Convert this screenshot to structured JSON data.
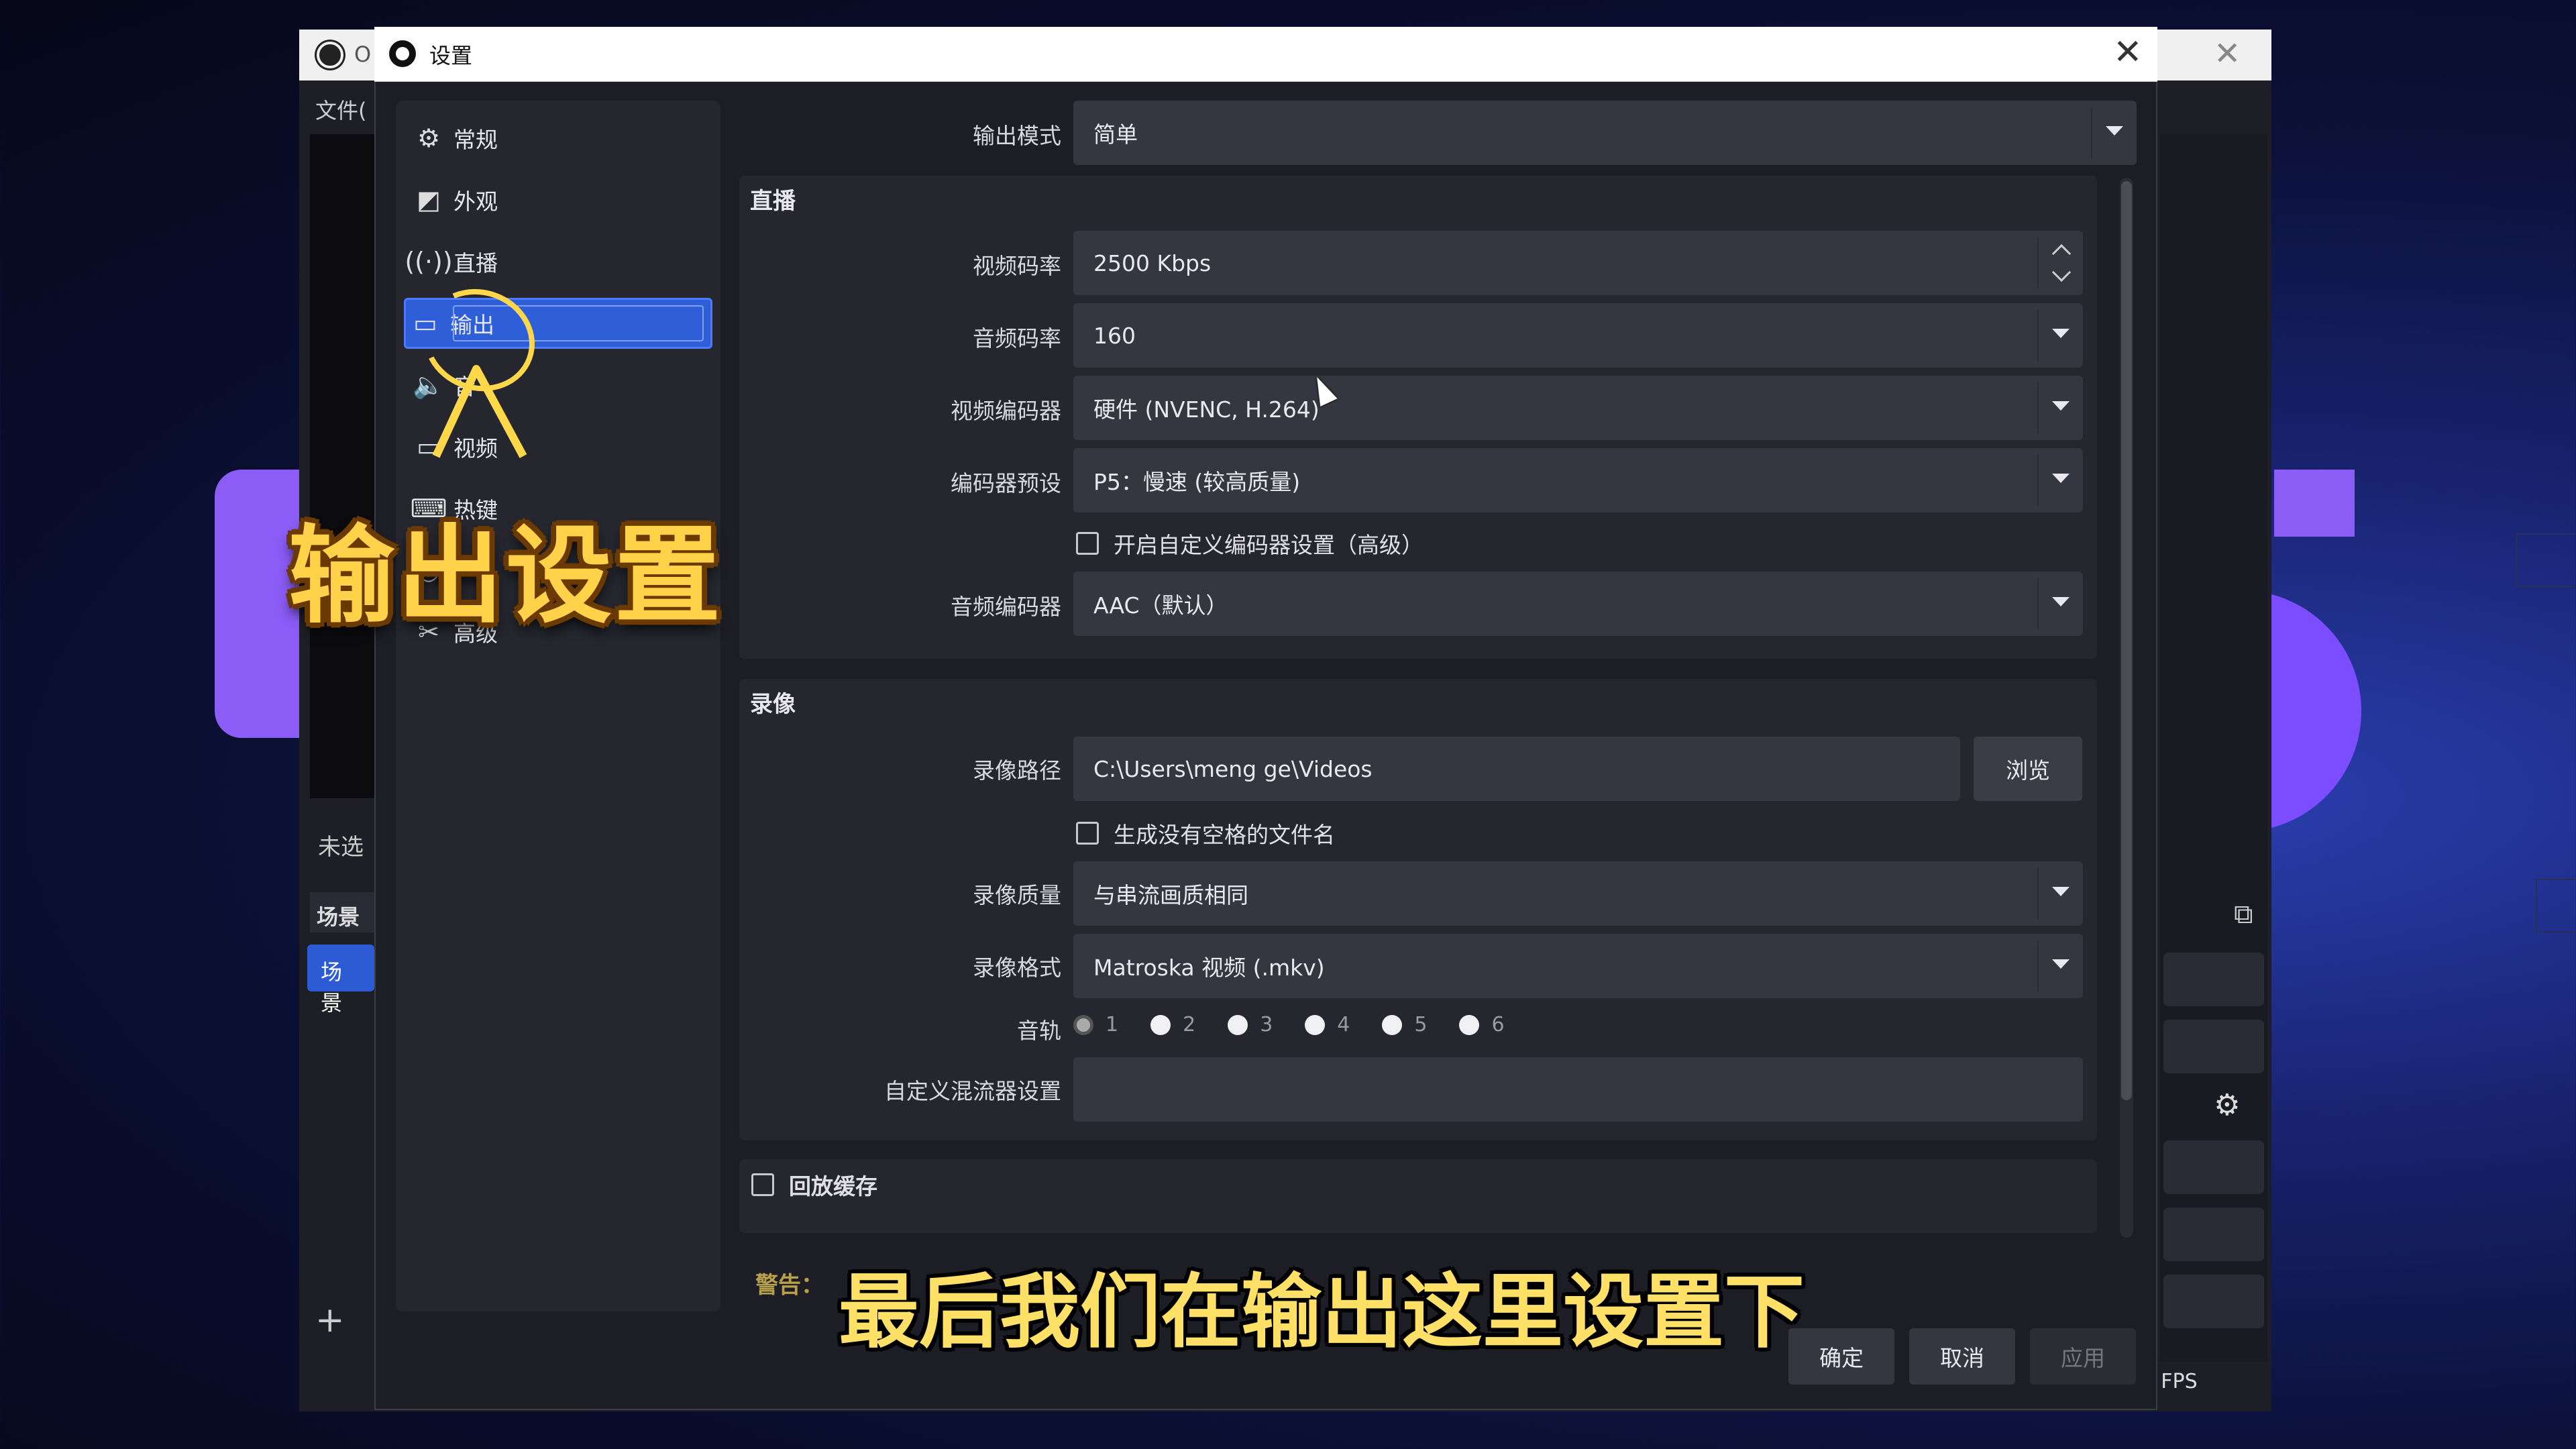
{
  "main_window": {
    "title_partial": "O",
    "menu_partial": "文件(",
    "left_label": "未选",
    "scenes_header": "场景",
    "scene_item": "场景",
    "fps_partial": ") FPS"
  },
  "dialog": {
    "title": "设置"
  },
  "sidebar": {
    "items": [
      {
        "label": "常规",
        "icon": "gear-icon"
      },
      {
        "label": "外观",
        "icon": "appearance-icon"
      },
      {
        "label": "直播",
        "icon": "broadcast-icon"
      },
      {
        "label": "输出",
        "icon": "output-icon",
        "active": true
      },
      {
        "label": "音",
        "icon": "speaker-icon"
      },
      {
        "label": "视频",
        "icon": "monitor-icon"
      },
      {
        "label": "热键",
        "icon": "hotkey-icon"
      },
      {
        "label": "",
        "icon": "accessibility-icon"
      },
      {
        "label": "高级",
        "icon": "tools-icon"
      }
    ]
  },
  "output": {
    "mode_label": "输出模式",
    "mode_value": "简单",
    "streaming": {
      "title": "直播",
      "video_bitrate_label": "视频码率",
      "video_bitrate_value": "2500 Kbps",
      "audio_bitrate_label": "音频码率",
      "audio_bitrate_value": "160",
      "video_encoder_label": "视频编码器",
      "video_encoder_value": "硬件 (NVENC, H.264)",
      "encoder_preset_label": "编码器预设",
      "encoder_preset_value": "P5：慢速 (较高质量)",
      "custom_encoder_label": "开启自定义编码器设置（高级）",
      "audio_encoder_label": "音频编码器",
      "audio_encoder_value": "AAC（默认）"
    },
    "recording": {
      "title": "录像",
      "path_label": "录像路径",
      "path_value": "C:\\Users\\meng ge\\Videos",
      "browse_label": "浏览",
      "no_space_label": "生成没有空格的文件名",
      "quality_label": "录像质量",
      "quality_value": "与串流画质相同",
      "format_label": "录像格式",
      "format_value": "Matroska 视频 (.mkv)",
      "tracks_label": "音轨",
      "tracks": [
        "1",
        "2",
        "3",
        "4",
        "5",
        "6"
      ],
      "mixer_label": "自定义混流器设置",
      "mixer_value": ""
    },
    "replay_buffer_label": "回放缓存",
    "warning_label": "警告："
  },
  "buttons": {
    "ok": "确定",
    "cancel": "取消",
    "apply": "应用"
  },
  "overlay": {
    "title": "输出设置",
    "caption": "最后我们在输出这里设置下"
  }
}
